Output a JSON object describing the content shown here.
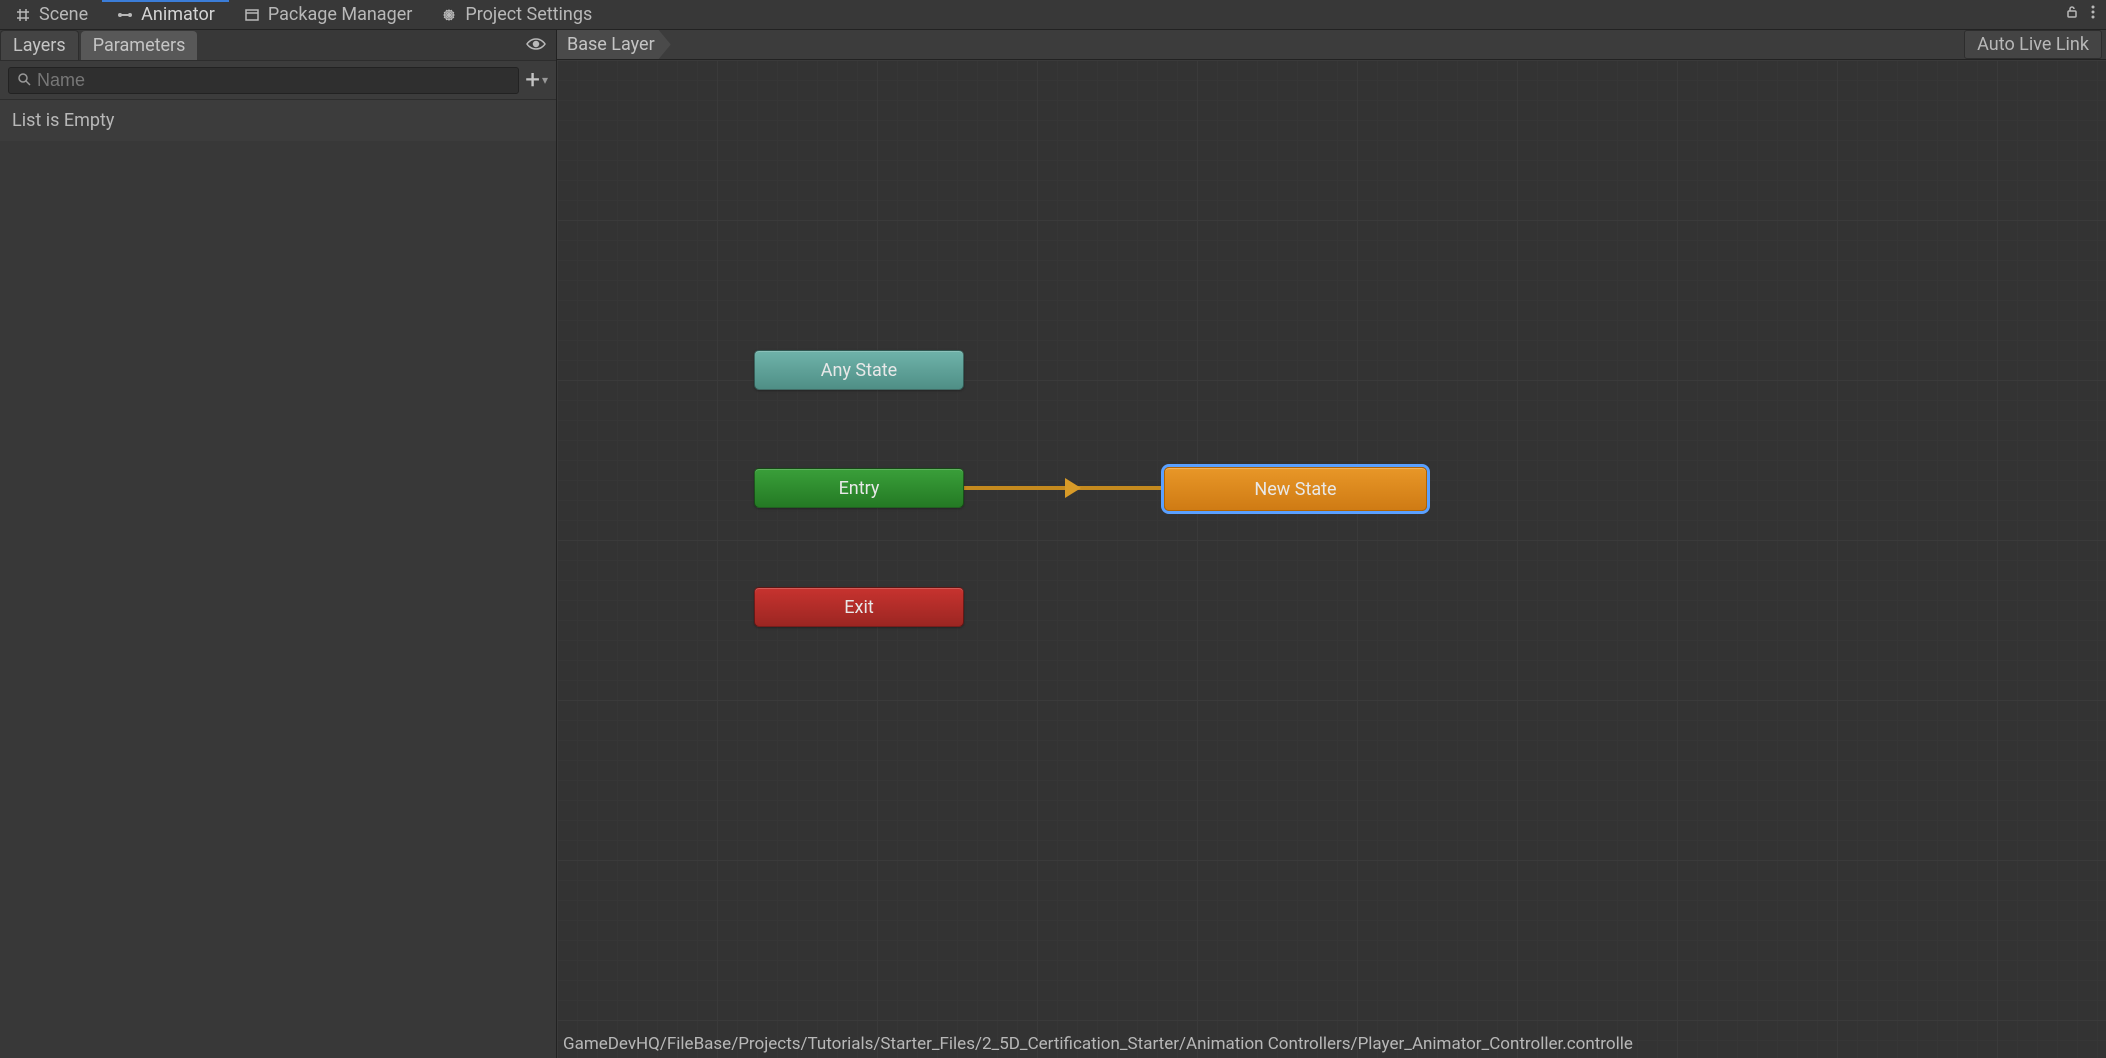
{
  "top_tabs": {
    "scene": "Scene",
    "animator": "Animator",
    "package_manager": "Package Manager",
    "project_settings": "Project Settings"
  },
  "left_panel": {
    "tabs": {
      "layers": "Layers",
      "parameters": "Parameters"
    },
    "search": {
      "placeholder": "Name"
    },
    "empty_message": "List is Empty"
  },
  "breadcrumb": {
    "base_layer": "Base Layer"
  },
  "auto_live_link": "Auto Live Link",
  "nodes": {
    "any_state": "Any State",
    "entry": "Entry",
    "exit": "Exit",
    "new_state": "New State"
  },
  "footer_path": "GameDevHQ/FileBase/Projects/Tutorials/Starter_Files/2_5D_Certification_Starter/Animation Controllers/Player_Animator_Controller.controlle"
}
